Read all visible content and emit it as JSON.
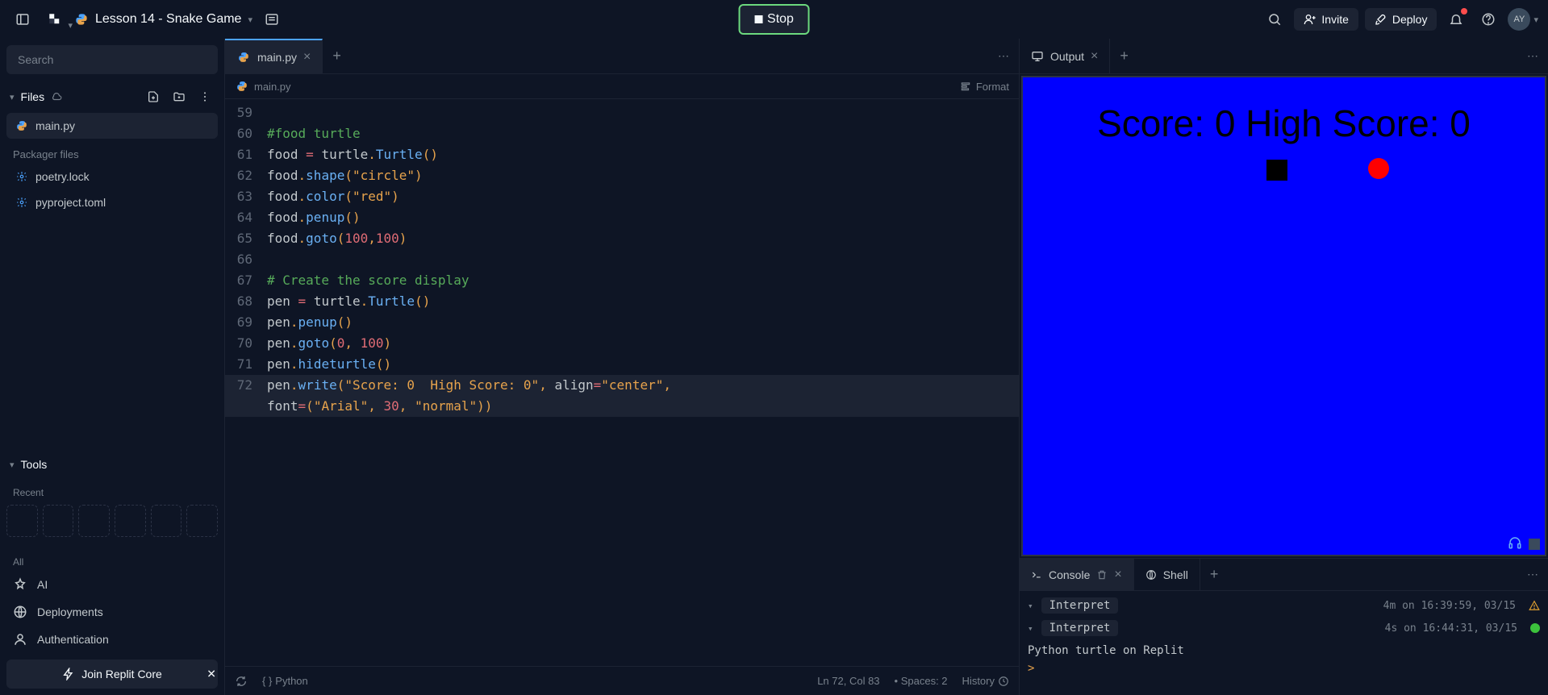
{
  "header": {
    "project_name": "Lesson 14 - Snake Game",
    "stop_label": "Stop",
    "invite_label": "Invite",
    "deploy_label": "Deploy",
    "avatar_initials": "AY"
  },
  "sidebar": {
    "search_placeholder": "Search",
    "files_label": "Files",
    "files": [
      {
        "name": "main.py",
        "active": true
      }
    ],
    "packager_label": "Packager files",
    "packager_files": [
      {
        "name": "poetry.lock"
      },
      {
        "name": "pyproject.toml"
      }
    ],
    "tools_label": "Tools",
    "recent_label": "Recent",
    "all_label": "All",
    "tools": [
      {
        "name": "AI"
      },
      {
        "name": "Deployments"
      },
      {
        "name": "Authentication"
      }
    ],
    "join_core": "Join Replit Core"
  },
  "editor": {
    "tab_name": "main.py",
    "breadcrumb_file": "main.py",
    "format_label": "Format",
    "code": [
      {
        "n": 59,
        "html": ""
      },
      {
        "n": 60,
        "html": "<span class='tok-comment'>#food turtle</span>"
      },
      {
        "n": 61,
        "html": "<span class='tok-name'>food</span> <span class='tok-op'>=</span> <span class='tok-name'>turtle</span><span class='tok-punct'>.</span><span class='tok-func'>Turtle</span><span class='tok-punct'>()</span>"
      },
      {
        "n": 62,
        "html": "<span class='tok-name'>food</span><span class='tok-punct'>.</span><span class='tok-func'>shape</span><span class='tok-punct'>(</span><span class='tok-string'>\"circle\"</span><span class='tok-punct'>)</span>"
      },
      {
        "n": 63,
        "html": "<span class='tok-name'>food</span><span class='tok-punct'>.</span><span class='tok-func'>color</span><span class='tok-punct'>(</span><span class='tok-string'>\"red\"</span><span class='tok-punct'>)</span>"
      },
      {
        "n": 64,
        "html": "<span class='tok-name'>food</span><span class='tok-punct'>.</span><span class='tok-func'>penup</span><span class='tok-punct'>()</span>"
      },
      {
        "n": 65,
        "html": "<span class='tok-name'>food</span><span class='tok-punct'>.</span><span class='tok-func'>goto</span><span class='tok-punct'>(</span><span class='tok-num'>100</span><span class='tok-punct'>,</span><span class='tok-num'>100</span><span class='tok-punct'>)</span>"
      },
      {
        "n": 66,
        "html": ""
      },
      {
        "n": 67,
        "html": "<span class='tok-comment'># Create the score display</span>"
      },
      {
        "n": 68,
        "html": "<span class='tok-name'>pen</span> <span class='tok-op'>=</span> <span class='tok-name'>turtle</span><span class='tok-punct'>.</span><span class='tok-func'>Turtle</span><span class='tok-punct'>()</span>"
      },
      {
        "n": 69,
        "html": "<span class='tok-name'>pen</span><span class='tok-punct'>.</span><span class='tok-func'>penup</span><span class='tok-punct'>()</span>"
      },
      {
        "n": 70,
        "html": "<span class='tok-name'>pen</span><span class='tok-punct'>.</span><span class='tok-func'>goto</span><span class='tok-punct'>(</span><span class='tok-num'>0</span><span class='tok-punct'>,</span> <span class='tok-num'>100</span><span class='tok-punct'>)</span>"
      },
      {
        "n": 71,
        "html": "<span class='tok-name'>pen</span><span class='tok-punct'>.</span><span class='tok-func'>hideturtle</span><span class='tok-punct'>()</span>"
      },
      {
        "n": 72,
        "html": "<span class='tok-name'>pen</span><span class='tok-punct'>.</span><span class='tok-func'>write</span><span class='tok-punct'>(</span><span class='tok-string'>\"Score: 0  High Score: 0\"</span><span class='tok-punct'>,</span> <span class='tok-name'>align</span><span class='tok-op'>=</span><span class='tok-string'>\"center\"</span><span class='tok-punct'>,</span> ",
        "hl": true
      },
      {
        "n": "",
        "html": "<span class='tok-name'>font</span><span class='tok-op'>=</span><span class='tok-punct'>(</span><span class='tok-string'>\"Arial\"</span><span class='tok-punct'>,</span> <span class='tok-num'>30</span><span class='tok-punct'>,</span> <span class='tok-string'>\"normal\"</span><span class='tok-punct'>))</span>",
        "hl": true
      }
    ],
    "status": {
      "lang": "Python",
      "position": "Ln 72, Col 83",
      "spaces": "Spaces: 2",
      "history": "History"
    }
  },
  "output": {
    "tab_name": "Output",
    "score_text": "Score: 0  High Score: 0"
  },
  "console": {
    "console_label": "Console",
    "shell_label": "Shell",
    "rows": [
      {
        "label": "Interpret",
        "time": "4m on 16:39:59, 03/15",
        "status": "warn"
      },
      {
        "label": "Interpret",
        "time": "4s on 16:44:31, 03/15",
        "status": "ok"
      }
    ],
    "output_line": "Python turtle on Replit",
    "prompt": ">"
  }
}
